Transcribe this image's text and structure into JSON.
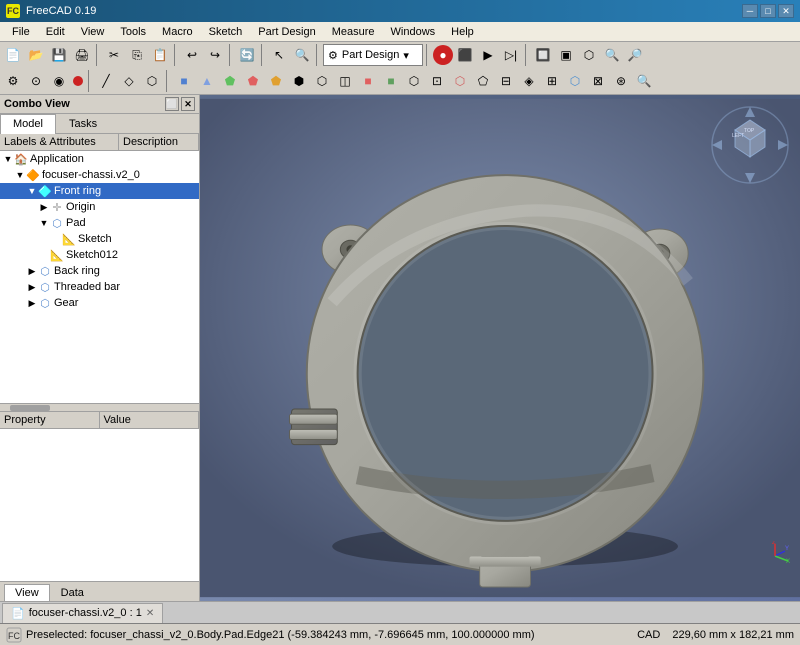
{
  "titlebar": {
    "title": "FreeCAD 0.19",
    "icon": "FC"
  },
  "menubar": {
    "items": [
      "File",
      "Edit",
      "View",
      "Tools",
      "Macro",
      "Sketch",
      "Part Design",
      "Measure",
      "Windows",
      "Help"
    ]
  },
  "toolbar1": {
    "dropdown_label": "Part Design"
  },
  "comboview": {
    "title": "Combo View",
    "tabs": [
      "Model",
      "Tasks"
    ],
    "active_tab": "Model"
  },
  "tree": {
    "headers": [
      "Labels & Attributes",
      "Description"
    ],
    "items": [
      {
        "id": "application",
        "label": "Application",
        "level": 0,
        "expanded": true,
        "icon": "app",
        "selected": false
      },
      {
        "id": "focuser",
        "label": "focuser-chassi.v2_0",
        "level": 1,
        "expanded": true,
        "icon": "part",
        "selected": false
      },
      {
        "id": "front-ring",
        "label": "Front ring",
        "level": 2,
        "expanded": true,
        "icon": "feature",
        "selected": true
      },
      {
        "id": "origin",
        "label": "Origin",
        "level": 3,
        "expanded": false,
        "icon": "origin",
        "selected": false
      },
      {
        "id": "pad",
        "label": "Pad",
        "level": 3,
        "expanded": true,
        "icon": "feature",
        "selected": false
      },
      {
        "id": "sketch",
        "label": "Sketch",
        "level": 4,
        "expanded": false,
        "icon": "sketch",
        "selected": false
      },
      {
        "id": "sketch012",
        "label": "Sketch012",
        "level": 3,
        "expanded": false,
        "icon": "sketch",
        "selected": false
      },
      {
        "id": "back-ring",
        "label": "Back ring",
        "level": 2,
        "expanded": false,
        "icon": "feature",
        "selected": false
      },
      {
        "id": "threaded-bar",
        "label": "Threaded bar",
        "level": 2,
        "expanded": false,
        "icon": "feature",
        "selected": false
      },
      {
        "id": "gear",
        "label": "Gear",
        "level": 2,
        "expanded": false,
        "icon": "feature",
        "selected": false
      }
    ]
  },
  "property": {
    "headers": [
      "Property",
      "Value"
    ]
  },
  "bottom_tabs": {
    "tabs": [
      "View",
      "Data"
    ],
    "active": "View"
  },
  "doc_tab": {
    "label": "focuser-chassi.v2_0 : 1",
    "icon": "📄"
  },
  "statusbar": {
    "text": "Preselected: focuser_chassi_v2_0.Body.Pad.Edge21 (-59.384243 mm, -7.696645 mm, 100.000000 mm)",
    "right1": "CAD",
    "right2": "229,60 mm x 182,21 mm"
  }
}
